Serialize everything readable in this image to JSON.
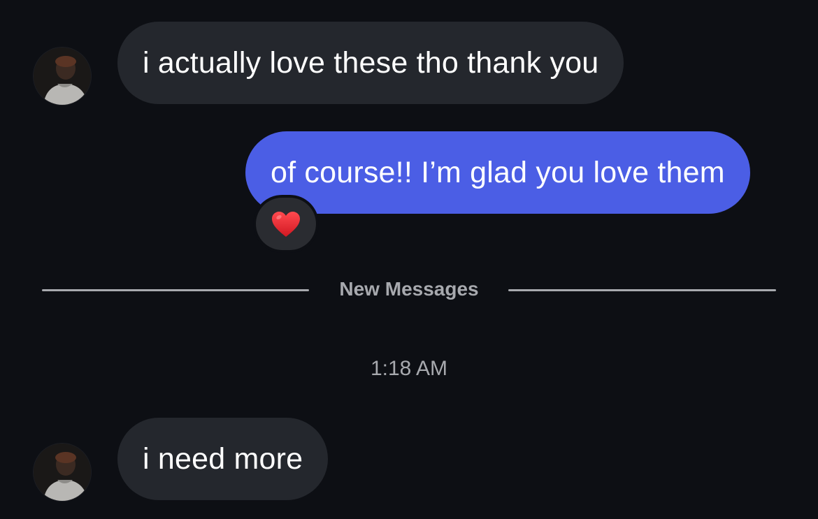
{
  "conversation": {
    "messages": [
      {
        "direction": "incoming",
        "text": "i actually love these tho thank you"
      },
      {
        "direction": "outgoing",
        "text": "of course!! I’m glad you love them",
        "reaction": "heart"
      },
      {
        "direction": "incoming",
        "text": "i need more"
      }
    ],
    "divider_label": "New Messages",
    "timestamp": "1:18 AM"
  },
  "colors": {
    "background": "#0d0f14",
    "incoming_bubble": "#24272d",
    "outgoing_bubble": "#4b5ee5",
    "meta_text": "#a7a9ae",
    "reaction_heart": "#e8202a"
  },
  "icons": {
    "reaction": "red-heart-icon",
    "avatar": "contact-avatar"
  }
}
